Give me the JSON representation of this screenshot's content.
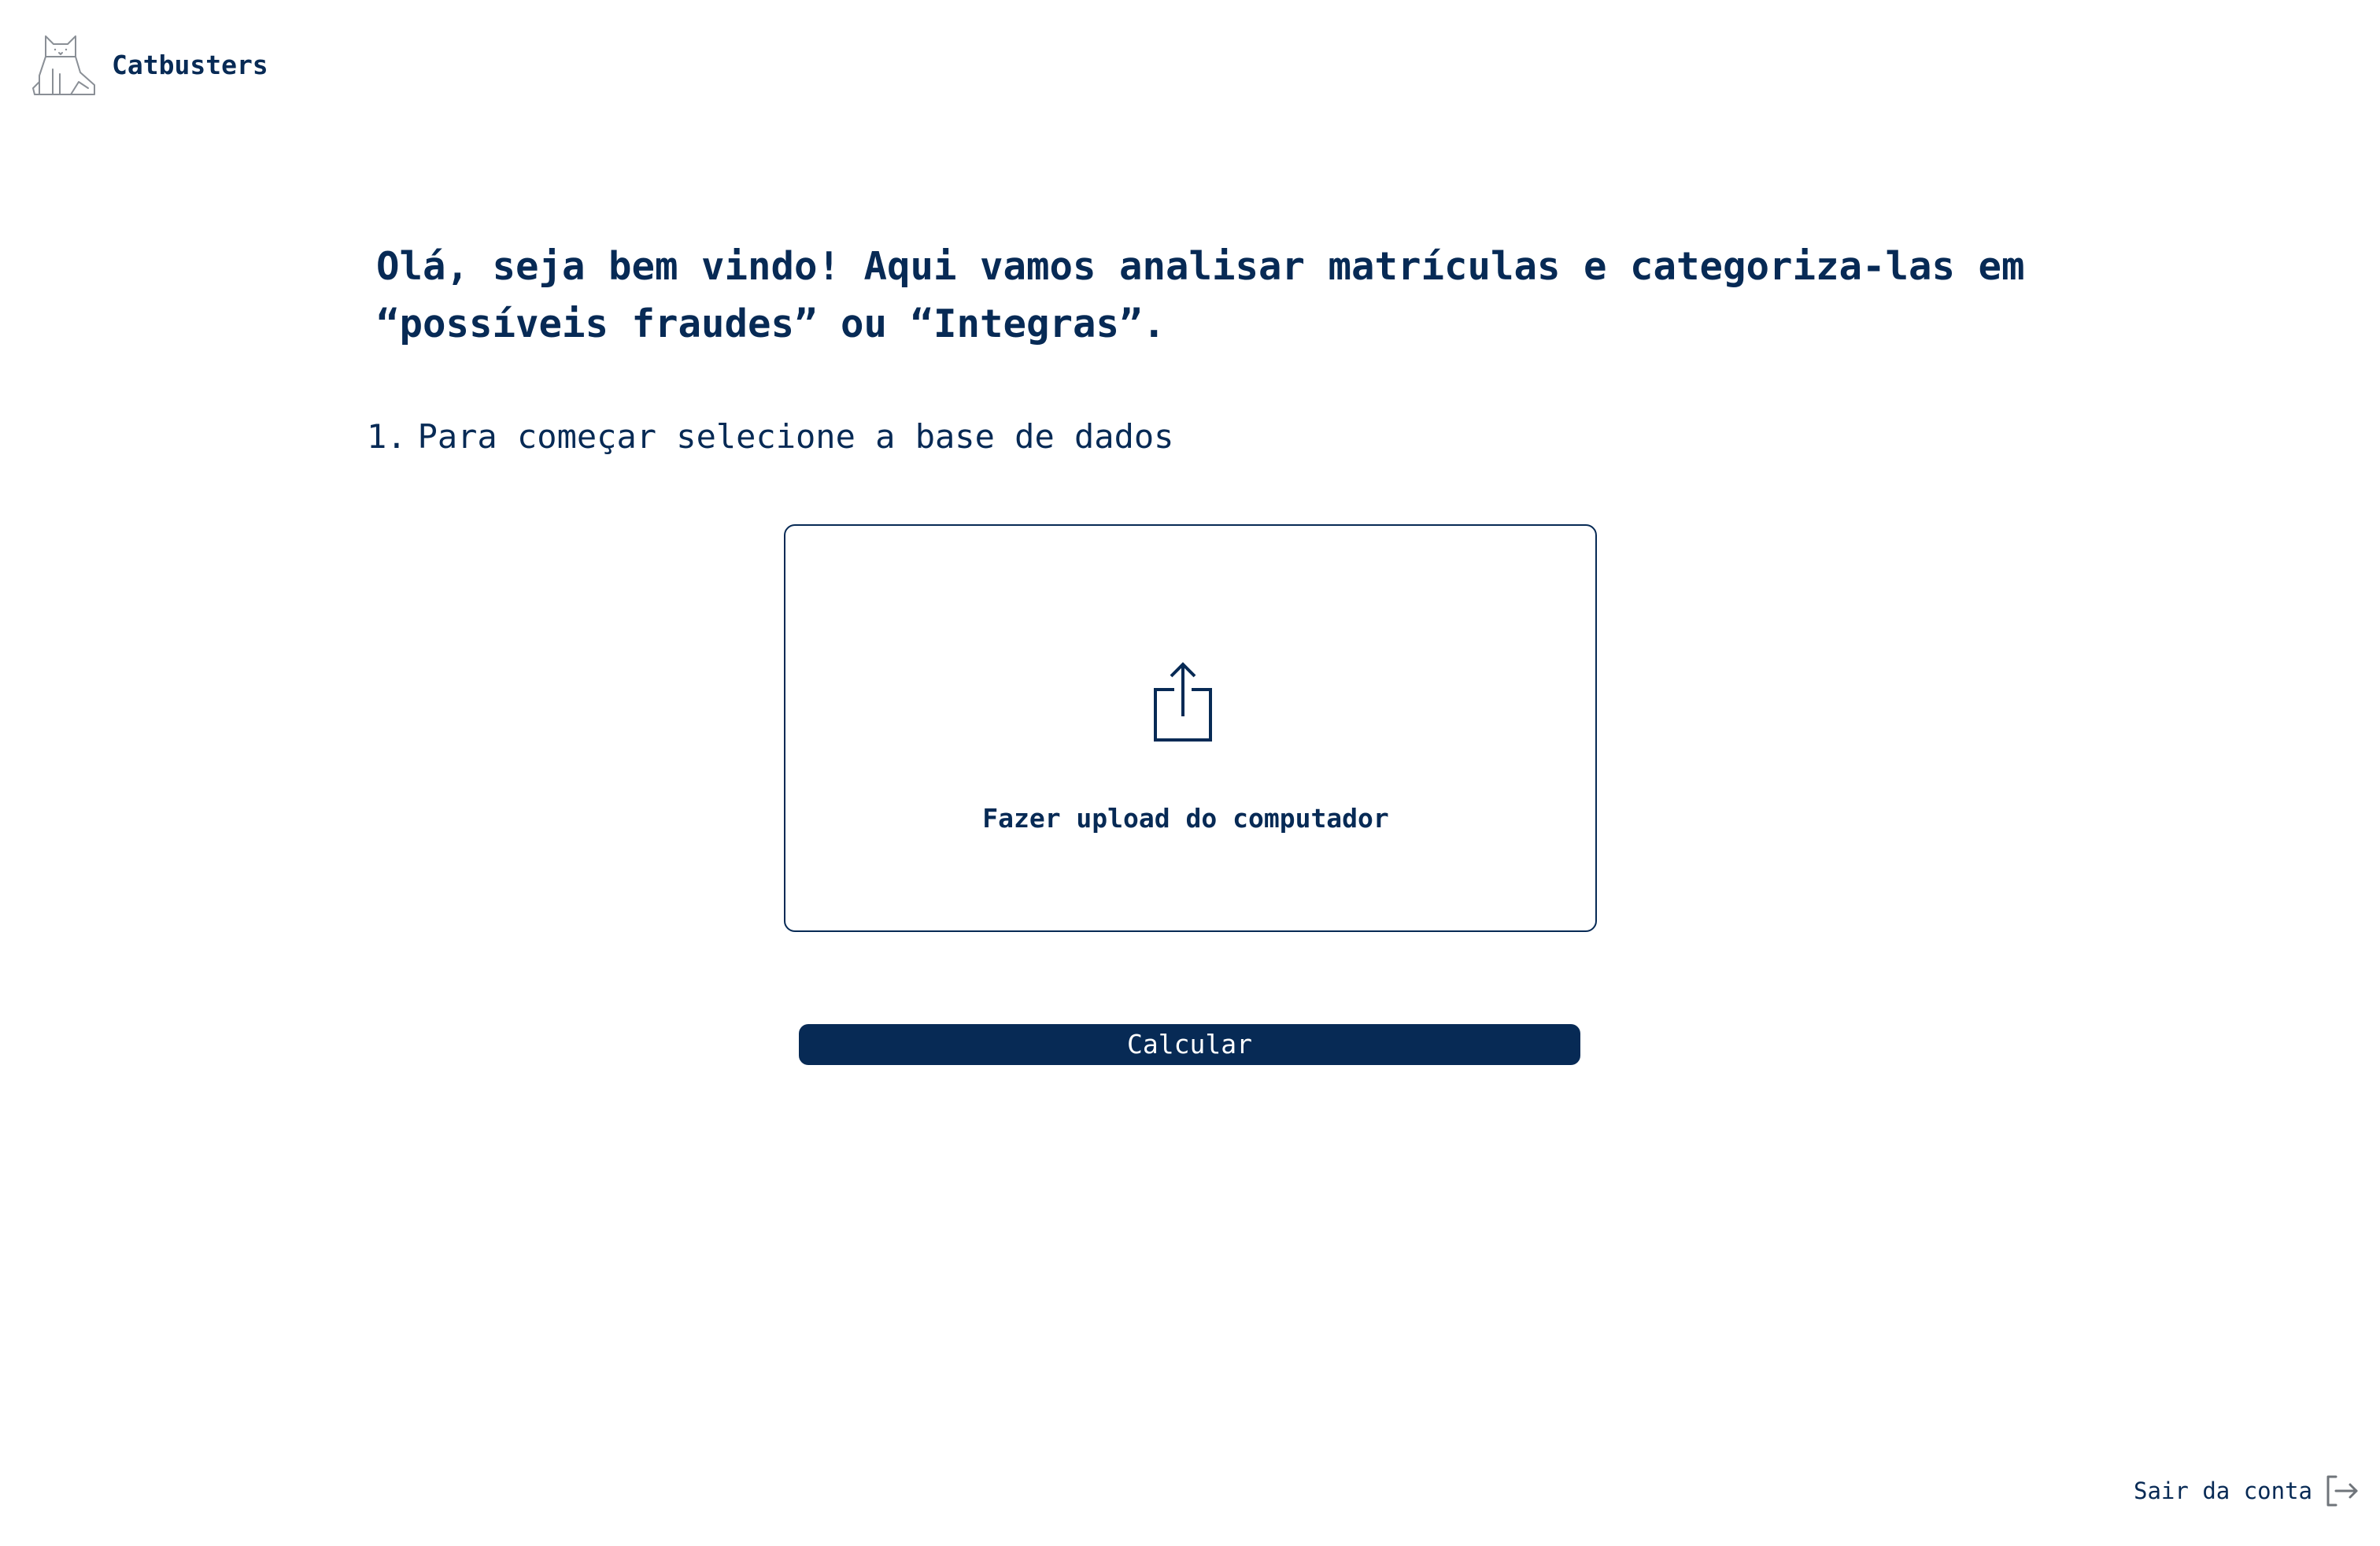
{
  "header": {
    "brand_name": "Catbusters",
    "logo_icon": "cat-icon"
  },
  "main": {
    "welcome_text": "Olá, seja bem vindo! Aqui vamos analisar matrículas e categoriza-las em “possíveis fraudes” ou “Integras”.",
    "step": {
      "number": "1.",
      "text": "Para começar selecione a base de dados"
    },
    "upload": {
      "icon": "upload-icon",
      "label": "Fazer upload do computador"
    },
    "calculate_label": "Calcular"
  },
  "footer": {
    "logout_label": "Sair da conta",
    "logout_icon": "logout-icon"
  },
  "colors": {
    "primary": "#072a55",
    "background": "#ffffff",
    "logo_stroke": "#8a8f96",
    "logout_icon": "#6f747a"
  }
}
